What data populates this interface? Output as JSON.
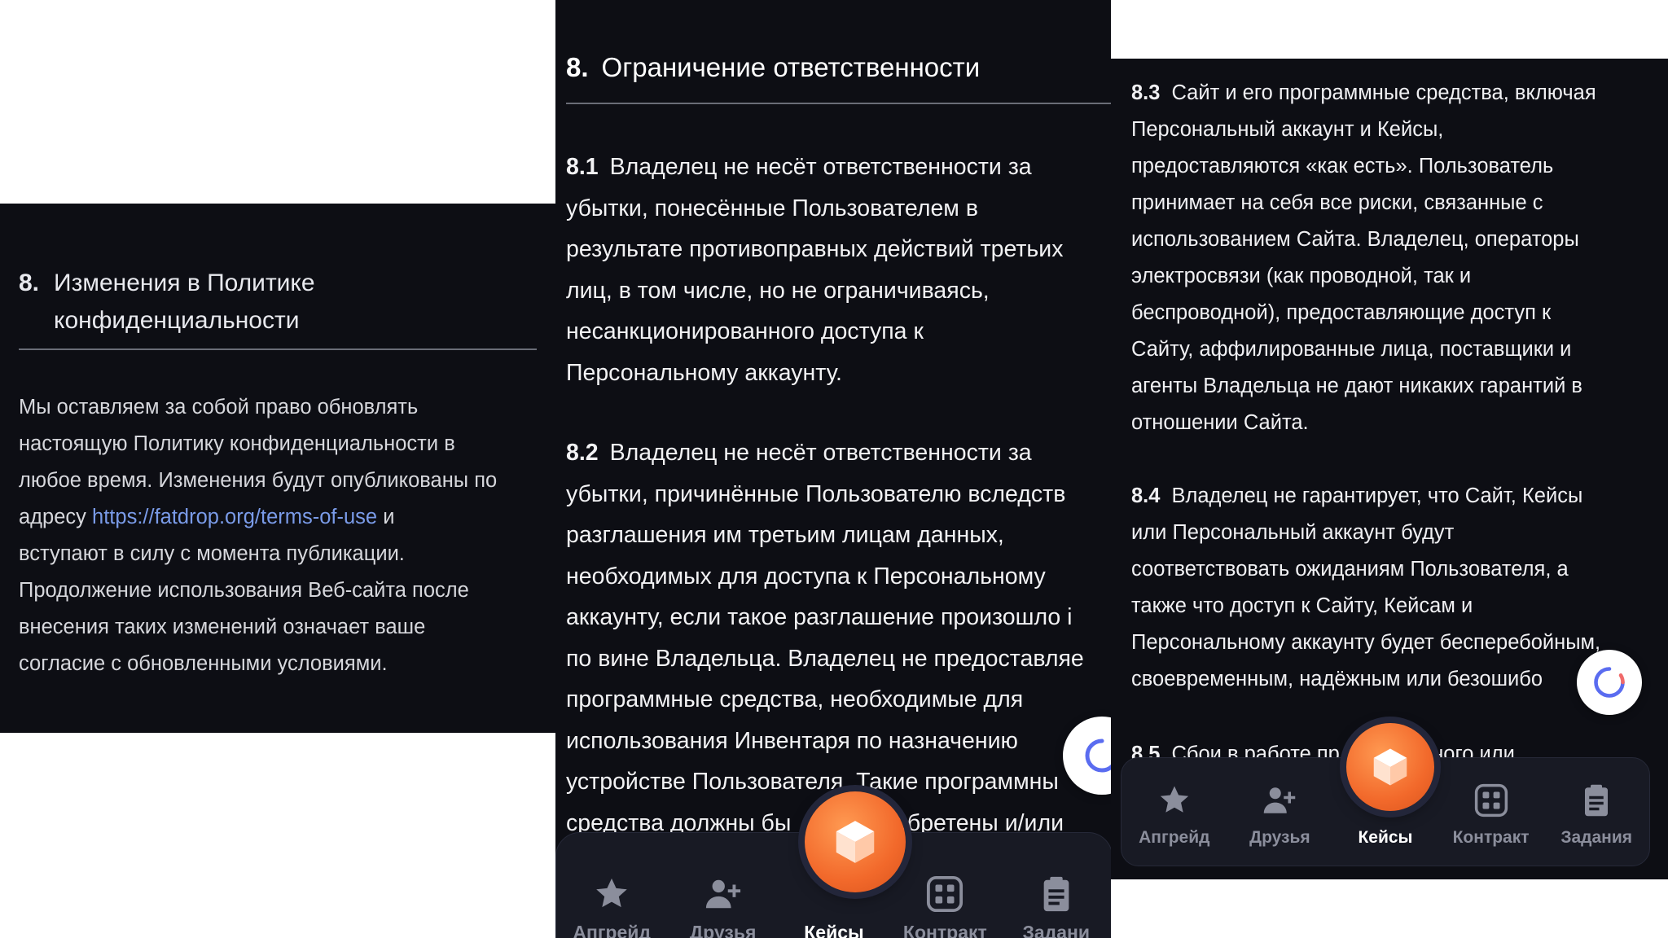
{
  "panel_left": {
    "section_number": "8.",
    "section_title_lines": [
      "Изменения в Политике",
      "конфиденциальности"
    ],
    "body_lines": [
      "Мы оставляем за собой право обновлять",
      "настоящую Политику конфиденциальности в",
      "любое время. Изменения будут опубликованы по"
    ],
    "line4_prefix": "адресу",
    "link_text": "https://fatdrop.org/terms-of-use",
    "line4_suffix": "и",
    "body_lines_after": [
      "вступают в силу с момента публикации.",
      "Продолжение использования Веб-сайта после",
      "внесения таких изменений означает ваше",
      "согласие с обновленными условиями."
    ]
  },
  "panel_middle": {
    "section_number": "8.",
    "section_title": "Ограничение ответственности",
    "p81_number": "8.1",
    "p81_lines": [
      "Владелец не несёт ответственности за",
      "убытки, понесённые Пользователем в",
      "результате противоправных действий третьих",
      "лиц, в том числе, но не ограничиваясь,",
      "несанкционированного доступа к",
      "Персональному аккаунту."
    ],
    "p82_number": "8.2",
    "p82_lines": [
      "Владелец не несёт ответственности за",
      "убытки, причинённые Пользователю вследств",
      "разглашения им третьим лицам данных,",
      "необходимых для доступа к Персональному",
      "аккаунту, если такое разглашение произошло і",
      "по вине Владельца. Владелец не предоставляе",
      "программные средства, необходимые для",
      "использования Инвентаря по назначению",
      "устройстве Пользователя. Такие программны",
      "средства должны бы                обретены и/или"
    ],
    "nav": [
      "Апгрейд",
      "Друзья",
      "Кейсы",
      "Контракт",
      "Задани"
    ]
  },
  "panel_right": {
    "p83_number": "8.3",
    "p83_lines": [
      "Сайт и его программные средства, включая",
      "Персональный аккаунт и Кейсы,",
      "предоставляются «как есть». Пользователь",
      "принимает на себя все риски, связанные с",
      "использованием Сайта. Владелец, операторы",
      "электросвязи (как проводной, так и",
      "беспроводной), предоставляющие доступ к",
      "Сайту, аффилированные лица, поставщики и",
      "агенты Владельца не дают никаких гарантий в",
      "отношении Сайта."
    ],
    "p84_number": "8.4",
    "p84_lines": [
      "Владелец не гарантирует, что Сайт, Кейсы",
      "или Персональный аккаунт будут",
      "соответствовать ожиданиям Пользователя, а",
      "также что доступ к Сайту, Кейсам и",
      "Персональному аккаунту будет бесперебойным,",
      "своевременным, надёжным или безошибо"
    ],
    "p85_number": "8.5",
    "p85_partial": "Сбои в работе пр                ного или",
    "nav": [
      "Апгрейд",
      "Друзья",
      "Кейсы",
      "Контракт",
      "Задания"
    ]
  },
  "icons": {
    "nav": [
      "star-icon",
      "add-friend-icon",
      "cube-icon",
      "grid-icon",
      "clipboard-icon"
    ],
    "fab": "assistant-icon"
  },
  "colors": {
    "background": "#0d0e14",
    "nav_bar": "#181a24",
    "accent": "#f2692b",
    "link": "#7a9be8",
    "nav_inactive": "#8b8e9c"
  }
}
